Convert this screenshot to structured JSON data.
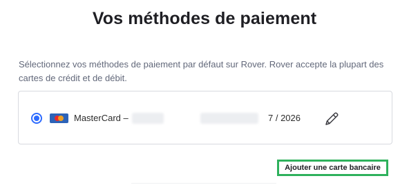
{
  "page": {
    "title": "Vos méthodes de paiement",
    "intro": "Sélectionnez vos méthodes de paiement par défaut sur Rover. Rover accepte la plupart des cartes de crédit et de débit."
  },
  "payment_methods": [
    {
      "brand_label": "MasterCard –",
      "expiry": "7 / 2026",
      "selected": true,
      "icon": "mastercard-icon",
      "edit_icon": "pencil-icon"
    }
  ],
  "actions": {
    "add_card_label": "Ajouter une carte bancaire"
  },
  "colors": {
    "accent_blue": "#2d6bff",
    "highlight_green": "#2eb15c",
    "title": "#1f1f24",
    "muted_text": "#62687a",
    "border": "#d7d9df"
  }
}
